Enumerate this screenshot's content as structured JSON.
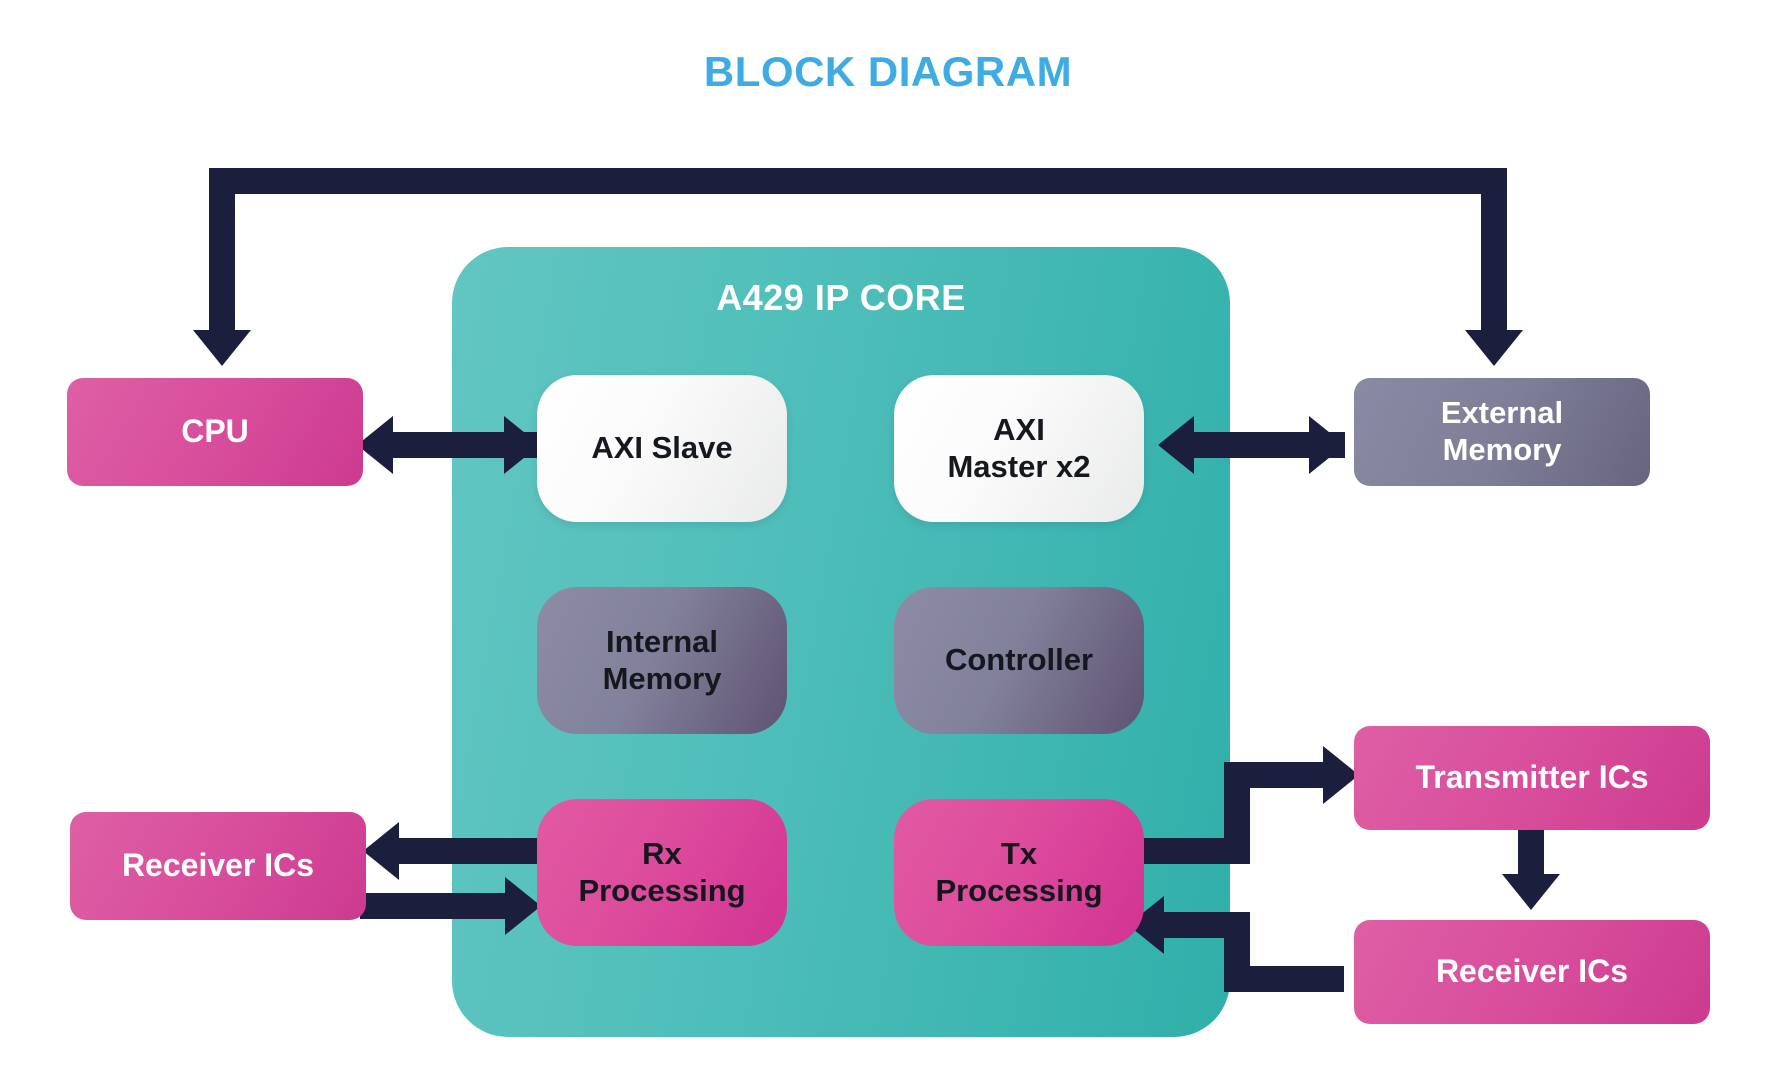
{
  "title": "BLOCK DIAGRAM",
  "colors": {
    "title": "#3EACE3",
    "core_teal": "#4FBEBA",
    "arrow_navy": "#1B1E3D",
    "pink": "#D84E9C",
    "gray_purple": "#7E7E98",
    "white_box": "#FFFFFF"
  },
  "core": {
    "label": "A429 IP CORE",
    "blocks": {
      "axi_slave": "AXI Slave",
      "axi_master_line1": "AXI",
      "axi_master_line2": "Master x2",
      "internal_memory_line1": "Internal",
      "internal_memory_line2": "Memory",
      "controller": "Controller",
      "rx_processing_line1": "Rx",
      "rx_processing_line2": "Processing",
      "tx_processing_line1": "Tx",
      "tx_processing_line2": "Processing"
    }
  },
  "external": {
    "cpu": "CPU",
    "external_memory_line1": "External",
    "external_memory_line2": "Memory",
    "receiver_ics_left": "Receiver ICs",
    "transmitter_ics": "Transmitter ICs",
    "receiver_ics_right": "Receiver ICs"
  }
}
